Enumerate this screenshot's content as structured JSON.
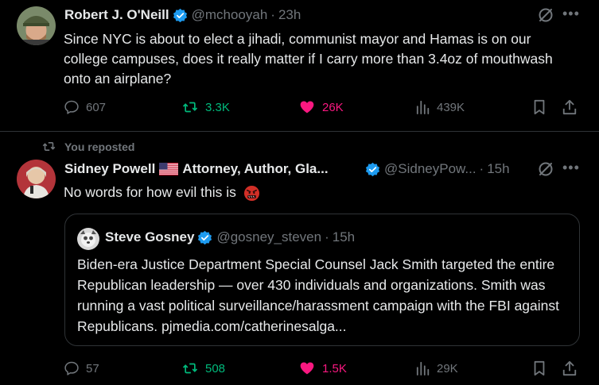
{
  "tweet1": {
    "display_name": "Robert J. O'Neill",
    "handle": "@mchooyah",
    "time": "23h",
    "text": "Since NYC is about to elect a jihadi, communist mayor and Hamas is on our college campuses, does it really matter if I carry more than 3.4oz of mouthwash onto an airplane?",
    "replies": "607",
    "reposts": "3.3K",
    "likes": "26K",
    "views": "439K"
  },
  "tweet2": {
    "repost_label": "You reposted",
    "display_name_part1": "Sidney Powell",
    "display_name_part2": "Attorney, Author, Gla...",
    "handle": "@SidneyPow...",
    "time": "15h",
    "text": "No words for how evil this is",
    "replies": "57",
    "reposts": "508",
    "likes": "1.5K",
    "views": "29K",
    "quote": {
      "display_name": "Steve Gosney",
      "handle": "@gosney_steven",
      "time": "15h",
      "text": "Biden-era Justice Department Special Counsel Jack Smith targeted the entire Republican leadership — over 430 individuals and organizations. Smith was running a vast political surveillance/harassment campaign with the FBI against Republicans. pjmedia.com/catherinesalga..."
    }
  },
  "separator": "·",
  "colors": {
    "background": "#000000",
    "text": "#e7e9ea",
    "muted": "#71767b",
    "verified": "#1d9bf0",
    "repost_active": "#00ba7c",
    "like_active": "#f91880",
    "border": "#2f3336"
  },
  "icons": [
    "verified-badge-icon",
    "grok-icon",
    "more-icon",
    "reply-icon",
    "repost-icon",
    "like-icon",
    "views-icon",
    "bookmark-icon",
    "share-icon",
    "us-flag-icon",
    "angry-emoji-icon"
  ]
}
